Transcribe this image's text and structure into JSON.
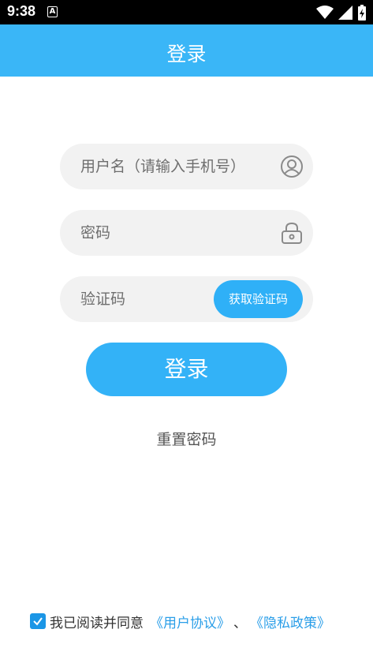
{
  "status_bar": {
    "time": "9:38",
    "notification_glyph": "A"
  },
  "header": {
    "title": "登录"
  },
  "form": {
    "username_placeholder": "用户名（请输入手机号）",
    "password_placeholder": "密码",
    "code_placeholder": "验证码",
    "get_code_label": "获取验证码"
  },
  "actions": {
    "login_label": "登录",
    "reset_password_label": "重置密码"
  },
  "agreement": {
    "checked": true,
    "prefix": "我已阅读并同意",
    "user_agreement": "《用户协议》",
    "separator": "、",
    "privacy_policy": "《隐私政策》"
  },
  "colors": {
    "accent": "#3ab6f7",
    "button": "#33b2f7",
    "field_bg": "#f2f2f2",
    "link": "#2a9ee8"
  }
}
